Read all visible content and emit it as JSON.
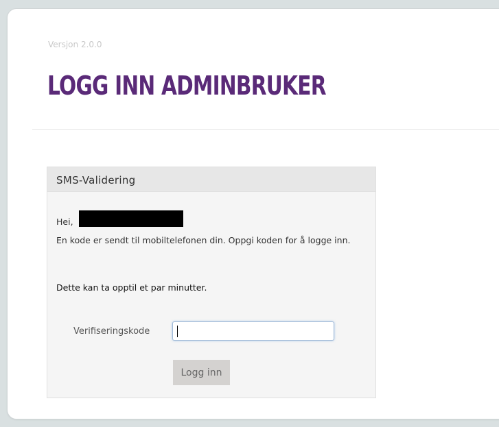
{
  "header": {
    "version": "Versjon 2.0.0",
    "title": "LOGG INN ADMINBRUKER"
  },
  "panel": {
    "title": "SMS-Validering",
    "greeting": "Hei,",
    "info_text": "En kode er sendt til mobiltelefonen din. Oppgi koden for å logge inn.",
    "notice": "Dette kan ta opptil et par minutter.",
    "code_label": "Verifiseringskode",
    "code_value": "",
    "login_button": "Logg inn"
  },
  "colors": {
    "title": "#5a2a78",
    "background": "#d9e0e1",
    "panel_header": "#e7e7e7",
    "button": "#d4d2d0"
  }
}
